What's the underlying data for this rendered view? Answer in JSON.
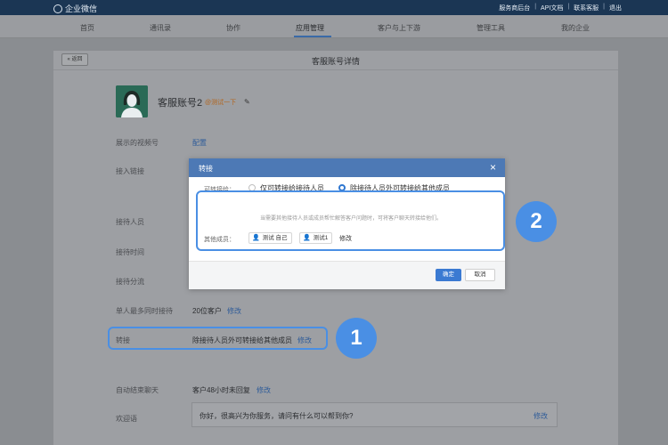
{
  "topbar": {
    "brand": "企业微信",
    "links": [
      "服务商后台",
      "API文档",
      "联系客服",
      "退出"
    ]
  },
  "nav": {
    "items": [
      "首页",
      "通讯录",
      "协作",
      "应用管理",
      "客户与上下游",
      "管理工具",
      "我的企业"
    ],
    "active": "应用管理"
  },
  "page": {
    "back_label": "« 返回",
    "title": "客服账号详情"
  },
  "account": {
    "name": "客服账号2",
    "tag": "@测试一下",
    "avatar_icon": "female-user-icon"
  },
  "rows": {
    "video_label": "展示的视频号",
    "video_value": "配置",
    "access_label": "接入链接",
    "agents_label": "接待人员",
    "time_label": "接待时间",
    "dispatch_label": "接待分流",
    "max_label": "单人最多同时接待",
    "max_value": "20位客户",
    "max_edit": "修改",
    "transfer_label": "转接",
    "transfer_value": "除接待人员外可转接给其他成员",
    "transfer_edit": "修改",
    "auto_label": "自动结束聊天",
    "auto_value": "客户48小时未回复",
    "auto_edit": "修改",
    "welcome_label": "欢迎语",
    "welcome_value": "你好，很高兴为你服务，请问有什么可以帮到你?",
    "welcome_edit": "修改"
  },
  "modal": {
    "title": "转接",
    "field_label": "可转接给：",
    "option1": "仅可转接给接待人员",
    "option2": "除接待人员外可转接给其他成员",
    "hint": "当需要其他接待人员或成员帮忙解答客户问题时，可将客户聊天转接给他们。",
    "members_label": "其他成员：",
    "members": [
      "测试 自己",
      "测试1"
    ],
    "members_edit": "修改",
    "ok_label": "确定",
    "cancel_label": "取消"
  },
  "annotations": {
    "badge1": "1",
    "badge2": "2",
    "accent": "#4a8fe4"
  }
}
